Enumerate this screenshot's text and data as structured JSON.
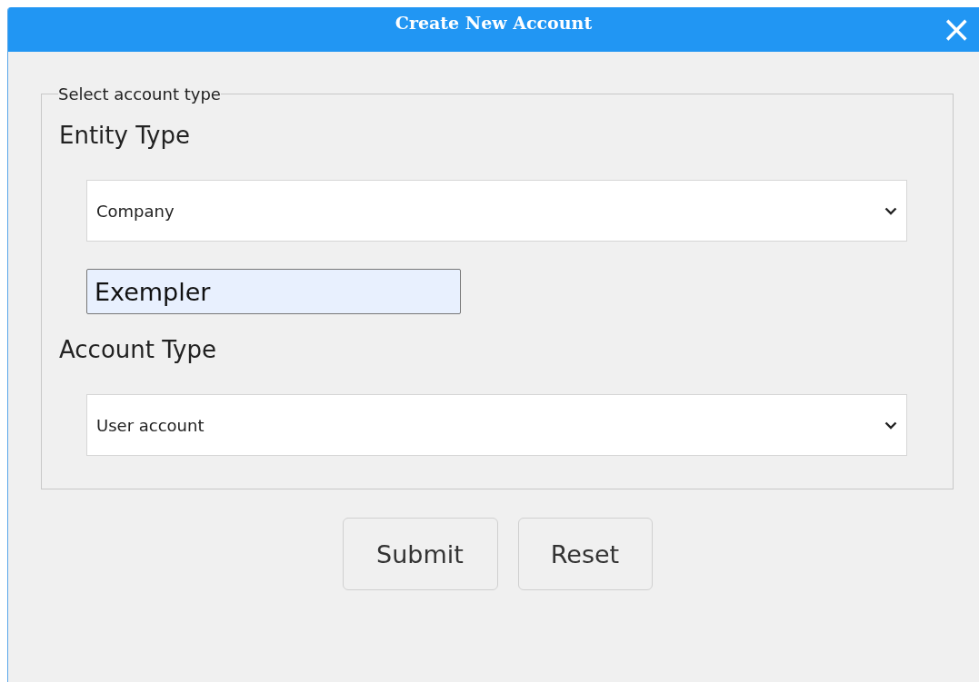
{
  "window": {
    "title": "Create New Account",
    "close": "×"
  },
  "fieldset": {
    "legend": "Select account type",
    "sections": [
      {
        "kind": "select",
        "heading": "Entity Type",
        "value": "Company",
        "extra_value": "Exempler"
      },
      {
        "kind": "select",
        "heading": "Account Type",
        "value": "User account"
      }
    ]
  },
  "buttons": [
    "Submit",
    "Reset"
  ]
}
